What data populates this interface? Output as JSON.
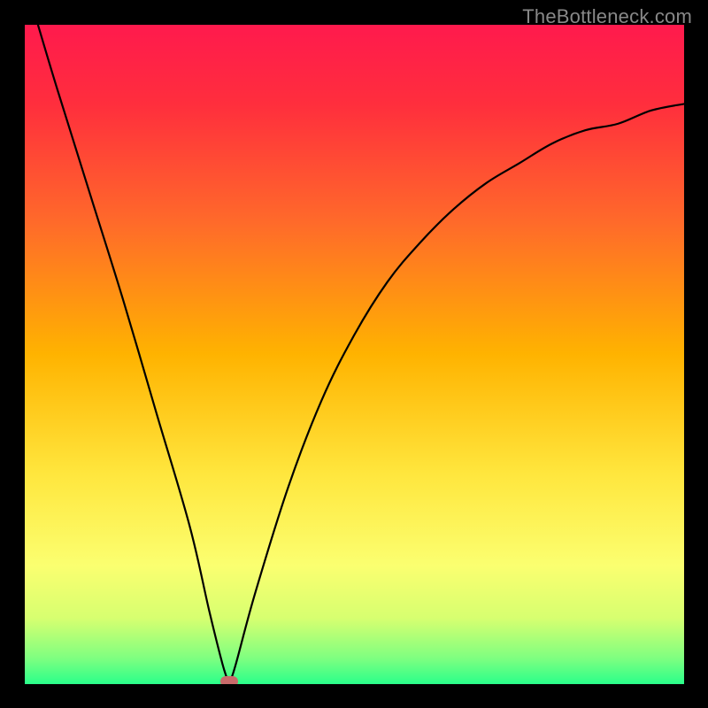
{
  "watermark": "TheBottleneck.com",
  "chart_data": {
    "type": "line",
    "title": "",
    "xlabel": "",
    "ylabel": "",
    "xlim": [
      0,
      100
    ],
    "ylim": [
      0,
      100
    ],
    "background": {
      "description": "vertical gradient red-yellow-green",
      "stops": [
        {
          "offset": 0.0,
          "color": "#ff1a4d"
        },
        {
          "offset": 0.12,
          "color": "#ff2e3d"
        },
        {
          "offset": 0.3,
          "color": "#ff6a2a"
        },
        {
          "offset": 0.5,
          "color": "#ffb300"
        },
        {
          "offset": 0.68,
          "color": "#ffe63d"
        },
        {
          "offset": 0.82,
          "color": "#fbff70"
        },
        {
          "offset": 0.9,
          "color": "#d7ff70"
        },
        {
          "offset": 0.96,
          "color": "#80ff80"
        },
        {
          "offset": 1.0,
          "color": "#2aff8a"
        }
      ]
    },
    "series": [
      {
        "name": "bottleneck-curve",
        "type": "cusp",
        "x": [
          2,
          5,
          10,
          15,
          20,
          25,
          28,
          30,
          31,
          32,
          35,
          40,
          45,
          50,
          55,
          60,
          65,
          70,
          75,
          80,
          85,
          90,
          95,
          100
        ],
        "y": [
          100,
          90,
          74,
          58,
          41,
          24,
          11,
          3,
          0,
          3,
          14,
          30,
          43,
          53,
          61,
          67,
          72,
          76,
          79,
          82,
          84,
          85,
          87,
          88
        ],
        "minimum": {
          "x": 31,
          "y": 0
        }
      }
    ],
    "marker": {
      "x": 31,
      "y": 0,
      "color": "#c96a6a",
      "shape": "rounded-pill"
    }
  }
}
